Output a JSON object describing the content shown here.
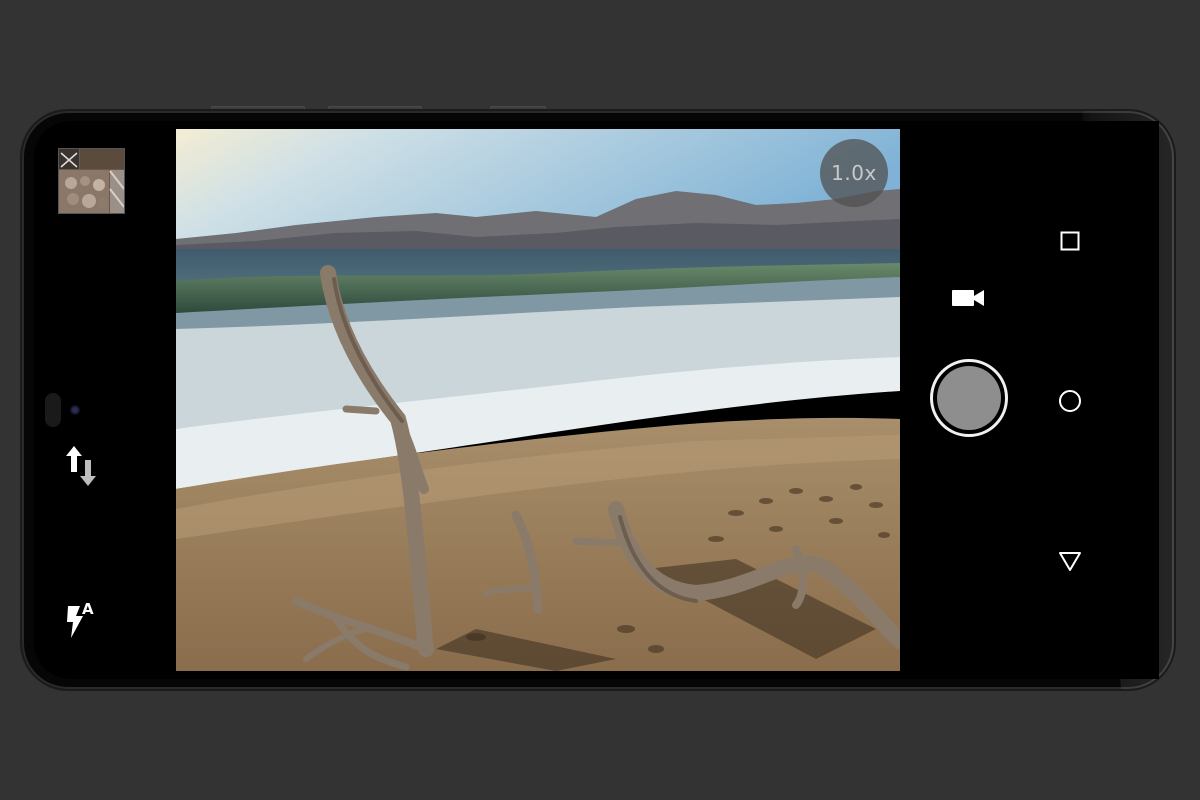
{
  "device": {
    "colors": {
      "background": "#333333",
      "bezel": "#060606",
      "screen": "#000000"
    }
  },
  "camera": {
    "zoom_label": "1.0x",
    "gallery_thumbnail": {
      "icon": "gallery-thumbnail"
    },
    "controls": {
      "switch_camera": {
        "icon": "switch-camera-icon"
      },
      "flash": {
        "icon": "flash-auto-icon",
        "mode": "A"
      },
      "video": {
        "icon": "video-camera-icon"
      },
      "shutter": {
        "icon": "shutter-button",
        "color": "#8e8e8e"
      }
    },
    "preview": {
      "scene": "beach-driftwood-mountains"
    }
  },
  "navigation_bar": {
    "buttons": [
      {
        "id": "recents",
        "icon": "square-recents-icon"
      },
      {
        "id": "home",
        "icon": "circle-home-icon"
      },
      {
        "id": "back",
        "icon": "triangle-back-icon"
      }
    ]
  }
}
